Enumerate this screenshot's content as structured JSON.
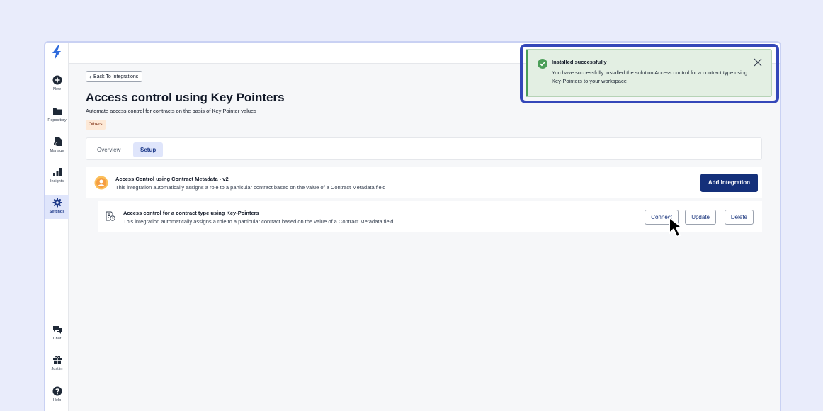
{
  "sidebar": {
    "items": [
      {
        "label": "New",
        "icon": "plus-circle-icon"
      },
      {
        "label": "Repository",
        "icon": "folder-icon"
      },
      {
        "label": "Manage",
        "icon": "file-gear-icon"
      },
      {
        "label": "Insights",
        "icon": "bar-chart-icon"
      },
      {
        "label": "Settings",
        "icon": "gear-icon",
        "active": true
      },
      {
        "label": "Chat",
        "icon": "chat-icon"
      },
      {
        "label": "Just in",
        "icon": "gift-icon"
      },
      {
        "label": "Help",
        "icon": "help-icon"
      }
    ]
  },
  "header": {
    "back_label": "Back To Integrations",
    "title": "Access control using Key Pointers",
    "subtitle": "Automate access control for contracts on the basis of Key Pointer values",
    "tag": "Others"
  },
  "tabs": [
    {
      "label": "Overview",
      "active": false
    },
    {
      "label": "Setup",
      "active": true
    }
  ],
  "integration": {
    "title": "Access Control using Contract Metadata - v2",
    "description": "This integration automatically assigns a role to a particular contract based on the value of a Contract Metadata field",
    "add_label": "Add Integration"
  },
  "solution": {
    "title": "Access control for a contract type using Key-Pointers",
    "description": "This integration automatically assigns a role to a particular contract based on the value of a Contract Metadata field",
    "connect_label": "Connect",
    "update_label": "Update",
    "delete_label": "Delete"
  },
  "toast": {
    "title": "Installed successfully",
    "message": "You have successfully installed the solution Access control for a contract type using Key-Pointers to your workspace"
  },
  "colors": {
    "primary": "#14307a",
    "success": "#4b9e58",
    "focus_ring": "#3447b9",
    "active_tab_bg": "#dfe5fb",
    "tag_bg": "#fde9d7"
  }
}
